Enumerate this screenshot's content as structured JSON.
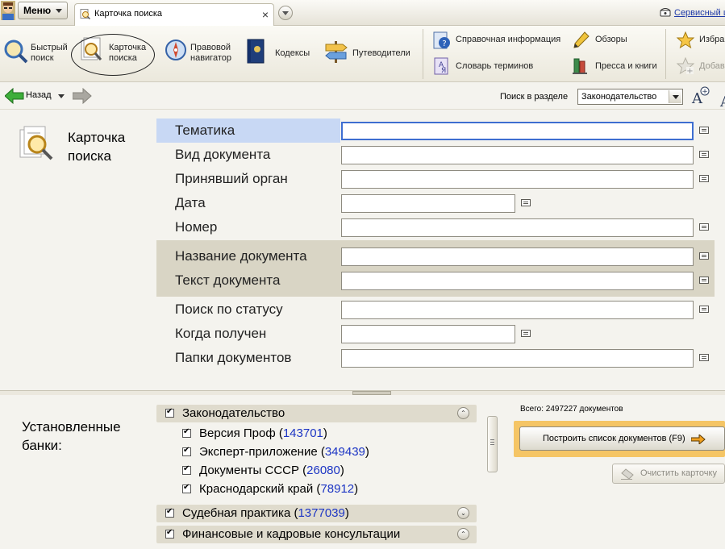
{
  "tabbar": {
    "menu_label": "Меню",
    "tab_title": "Карточка поиска",
    "tab_close": "×",
    "service_label": "Сервисный ц"
  },
  "toolbar": {
    "quick_search": "Быстрый\nпоиск",
    "search_card": "Карточка\nпоиска",
    "legal_navigator": "Правовой\nнавигатор",
    "codes": "Кодексы",
    "guides": "Путеводители",
    "reference_info": "Справочная информация",
    "dictionary": "Словарь терминов",
    "reviews": "Обзоры",
    "press": "Пресса и книги",
    "favorites": "Избран",
    "add": "Добав"
  },
  "navbar": {
    "back_label": "Назад",
    "search_in_label": "Поиск в разделе",
    "section_value": "Законодательство"
  },
  "card": {
    "title": "Карточка\nпоиска",
    "fields": [
      {
        "label": "Тематика",
        "value": ""
      },
      {
        "label": "Вид документа",
        "value": ""
      },
      {
        "label": "Принявший орган",
        "value": ""
      },
      {
        "label": "Дата",
        "value": ""
      },
      {
        "label": "Номер",
        "value": ""
      },
      {
        "label": "Название документа",
        "value": ""
      },
      {
        "label": "Текст документа",
        "value": ""
      },
      {
        "label": "Поиск по статусу",
        "value": ""
      },
      {
        "label": "Когда получен",
        "value": ""
      },
      {
        "label": "Папки документов",
        "value": ""
      }
    ]
  },
  "banks": {
    "label": "Установленные\nбанки:",
    "groups": [
      {
        "name": "Законодательство",
        "count": "",
        "toggle": "⌃",
        "items": [
          {
            "name": "Версия Проф (",
            "count": "143701",
            "close": ")"
          },
          {
            "name": "Эксперт-приложение (",
            "count": "349439",
            "close": ")"
          },
          {
            "name": "Документы СССР (",
            "count": "26080",
            "close": ")"
          },
          {
            "name": "Краснодарский край (",
            "count": "78912",
            "close": ")"
          }
        ]
      },
      {
        "name": "Судебная практика (",
        "count": "1377039",
        "close": ")",
        "toggle": "⌄"
      },
      {
        "name": "Финансовые и кадровые консультации",
        "count": "",
        "close": "",
        "toggle": "⌃"
      }
    ],
    "total": "Всего: 2497227 документов",
    "build_button": "Построить список документов (F9)",
    "clear_button": "Очистить карточку"
  },
  "colors": {
    "accent_orange": "#f5c565",
    "link_blue": "#1c35c4",
    "field_focus": "#3e6ed1",
    "row_highlight": "#c8d8f4",
    "row_beige": "#d9d5c5"
  }
}
